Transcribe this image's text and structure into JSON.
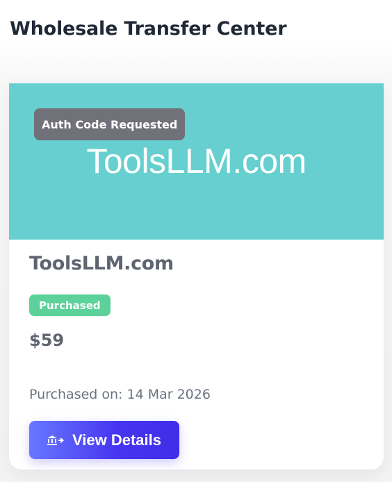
{
  "header": {
    "title": "Wholesale Transfer Center"
  },
  "card": {
    "banner": {
      "domain": "ToolsLLM.com",
      "status_overlay": "Auth Code Requested",
      "background_color": "#67cfcf"
    },
    "domain_name": "ToolsLLM.com",
    "status": "Purchased",
    "price": "$59",
    "purchase_date": "Purchased on: 14 Mar 2026",
    "view_button": {
      "label": "View Details",
      "icon": "bank-arrow-icon"
    }
  }
}
